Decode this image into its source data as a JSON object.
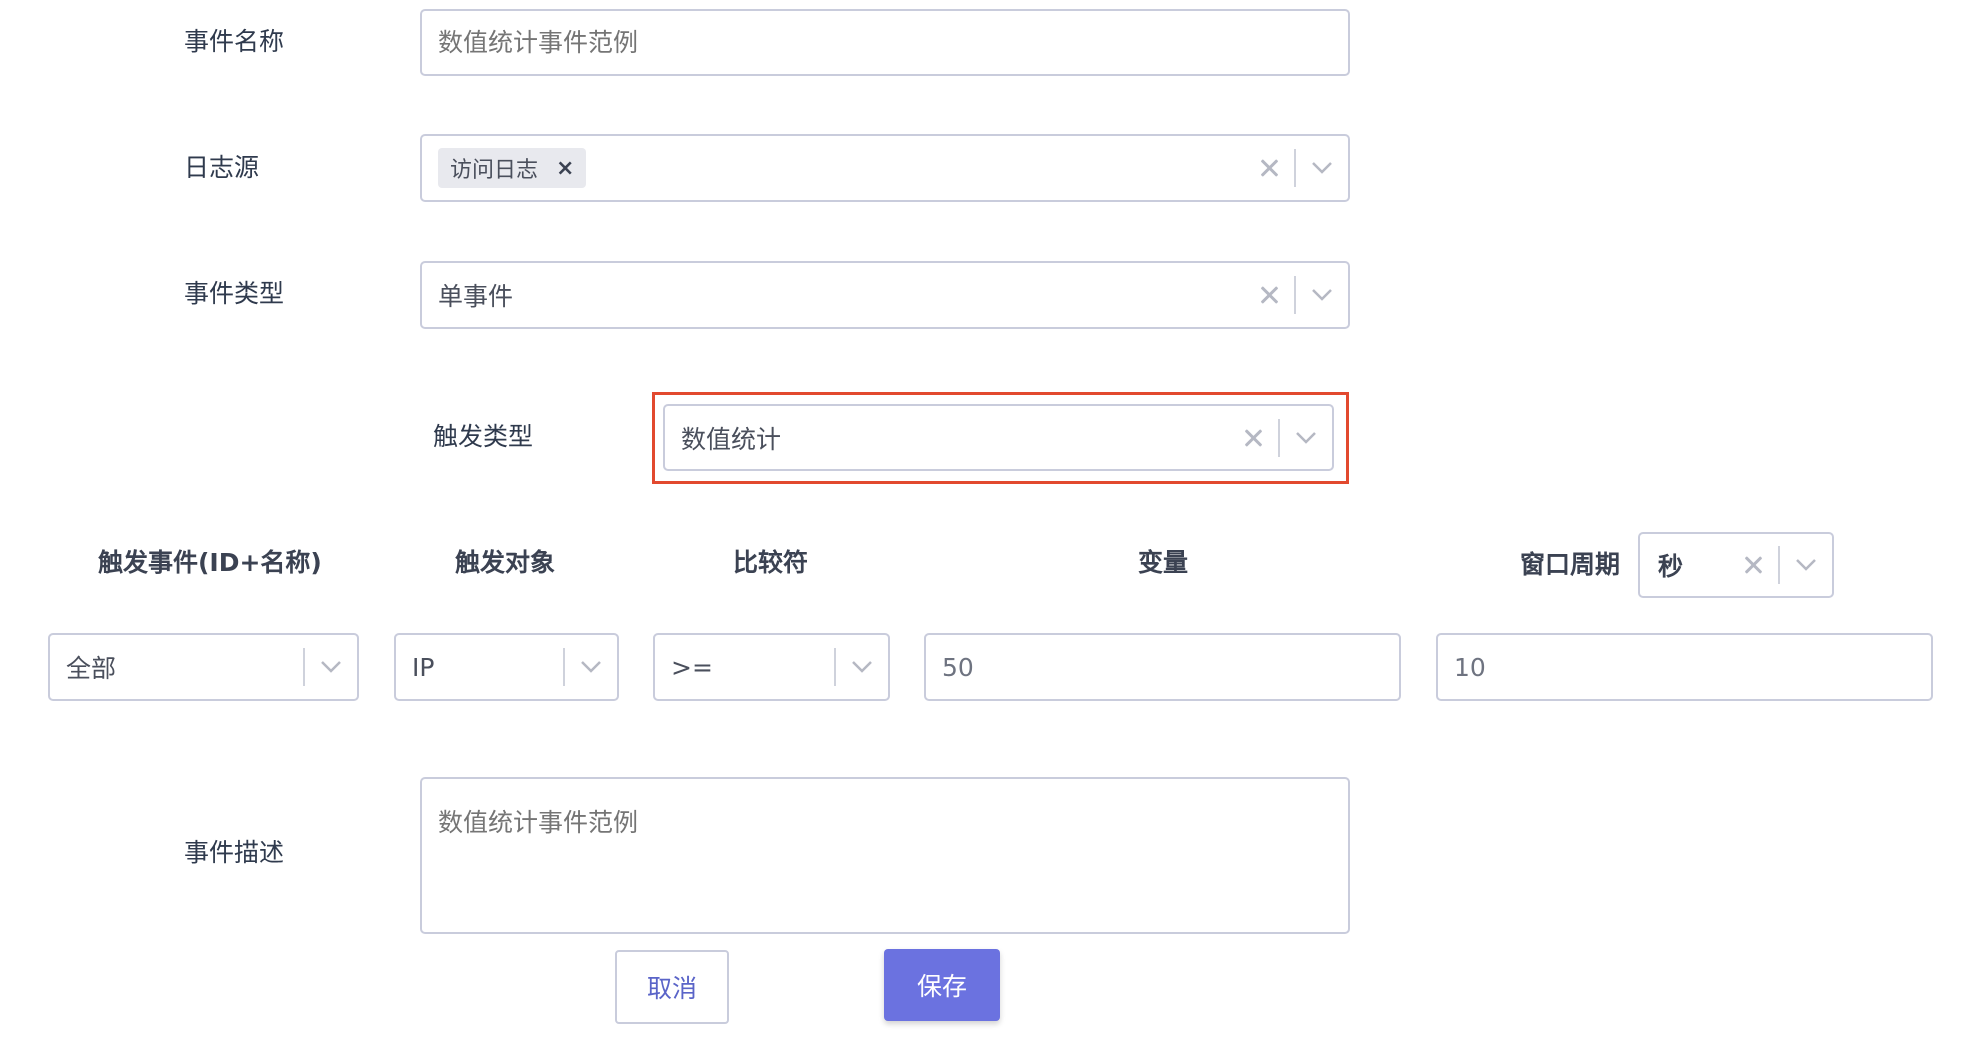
{
  "form": {
    "event_name": {
      "label": "事件名称",
      "placeholder": "数值统计事件范例"
    },
    "log_source": {
      "label": "日志源",
      "tag": "访问日志",
      "tag_remove": "×"
    },
    "event_type": {
      "label": "事件类型",
      "value": "单事件"
    },
    "trigger_type": {
      "label": "触发类型",
      "value": "数值统计"
    },
    "columns": {
      "trigger_event": "触发事件(ID+名称)",
      "trigger_object": "触发对象",
      "comparator": "比较符",
      "variable": "变量",
      "window_period": "窗口周期",
      "window_unit": "秒"
    },
    "row": {
      "trigger_event": "全部",
      "trigger_object": "IP",
      "comparator": ">=",
      "variable": "50",
      "window_value": "10"
    },
    "description": {
      "label": "事件描述",
      "placeholder": "数值统计事件范例"
    },
    "buttons": {
      "cancel": "取消",
      "save": "保存"
    }
  },
  "colors": {
    "accent": "#6b72e0",
    "highlight_border": "#e2492f",
    "field_border": "#c9ccdc"
  }
}
